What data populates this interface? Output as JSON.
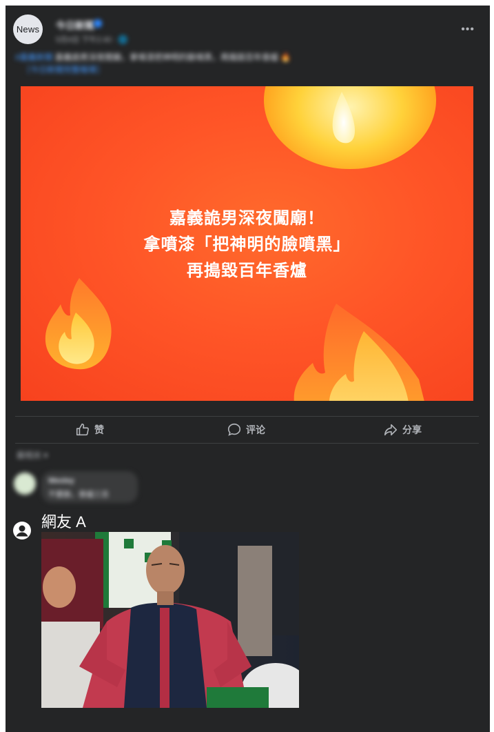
{
  "header": {
    "avatar_text": "News",
    "page_name": "今日新聞",
    "meta": "5月4日 下午2:40 · 🌐",
    "more_icon": "more-horizontal-icon"
  },
  "caption": {
    "tag": "#嘉義新聞",
    "text": "嘉義詭男深夜闖廟，拿噴漆把神明的臉噴黑，再搗毀百年香爐 🔥",
    "link": "［今日新聞完整報導］"
  },
  "image": {
    "lines": [
      "嘉義詭男深夜闖廟！",
      "拿噴漆「把神明的臉噴黑」",
      "再搗毀百年香爐"
    ],
    "bg_color": "#ff5527"
  },
  "actions": {
    "like_label": "赞",
    "comment_label": "评论",
    "share_label": "分享"
  },
  "comments": {
    "sort_label": "最相关 ▾",
    "first": {
      "name": "Wesley",
      "text": "不要臉，香爐三百"
    },
    "second": {
      "name": "網友 A"
    }
  },
  "colors": {
    "card": "#242526",
    "text": "#e4e6eb",
    "muted": "#b0b3b8",
    "accent": "#4599ff"
  }
}
